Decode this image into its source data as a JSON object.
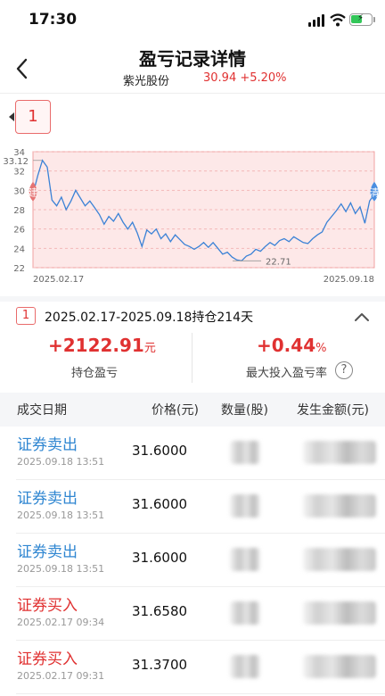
{
  "status": {
    "time": "17:30"
  },
  "header": {
    "title": "盈亏记录详情",
    "stock_name": "紫光股份",
    "stock_price": "30.94 +5.20%"
  },
  "badge": {
    "number": "1"
  },
  "chart_data": {
    "type": "line",
    "x_start": "2025.02.17",
    "x_end": "2025.09.18",
    "ylim": [
      22,
      34
    ],
    "y_ticks": [
      "34",
      "32",
      "30",
      "28",
      "26",
      "24",
      "22"
    ],
    "max_label": "33.12",
    "min_label": "22.71",
    "buy_marker": "建",
    "clear_marker": "清",
    "values": [
      29.6,
      31.5,
      33.1,
      32.4,
      29.0,
      28.4,
      29.3,
      28.0,
      28.9,
      30.0,
      29.2,
      28.4,
      28.9,
      28.2,
      27.5,
      26.5,
      27.3,
      26.8,
      27.6,
      26.7,
      26.0,
      26.7,
      25.6,
      24.2,
      25.9,
      25.5,
      26.0,
      25.0,
      25.5,
      24.7,
      25.4,
      24.9,
      24.4,
      24.2,
      23.9,
      24.2,
      24.6,
      24.1,
      24.6,
      24.0,
      23.4,
      23.6,
      23.1,
      22.8,
      22.71,
      23.2,
      23.4,
      23.9,
      23.7,
      24.2,
      24.6,
      24.3,
      24.8,
      25.0,
      24.7,
      25.2,
      24.9,
      24.6,
      24.5,
      25.0,
      25.4,
      25.7,
      26.7,
      27.3,
      27.9,
      28.6,
      27.8,
      28.7,
      27.6,
      28.3,
      26.6,
      28.9,
      29.6
    ]
  },
  "summary": {
    "badge": "1",
    "range_text": "2025.02.17-2025.09.18持仓214天",
    "profit_value": "+2122.91",
    "profit_unit": "元",
    "profit_label": "持仓盈亏",
    "rate_value": "+0.44",
    "rate_unit": "%",
    "rate_label": "最大投入盈亏率",
    "help_icon": "?"
  },
  "table": {
    "headers": [
      "成交日期",
      "价格(元)",
      "数量(股)",
      "发生金额(元)"
    ],
    "rows": [
      {
        "type": "证券卖出",
        "kind": "sell",
        "time": "2025.09.18 13:51",
        "price": "31.6000"
      },
      {
        "type": "证券卖出",
        "kind": "sell",
        "time": "2025.09.18 13:51",
        "price": "31.6000"
      },
      {
        "type": "证券卖出",
        "kind": "sell",
        "time": "2025.09.18 13:51",
        "price": "31.6000"
      },
      {
        "type": "证券买入",
        "kind": "buy",
        "time": "2025.02.17 09:34",
        "price": "31.6580"
      },
      {
        "type": "证券买入",
        "kind": "buy",
        "time": "2025.02.17 09:31",
        "price": "31.3700"
      }
    ]
  }
}
